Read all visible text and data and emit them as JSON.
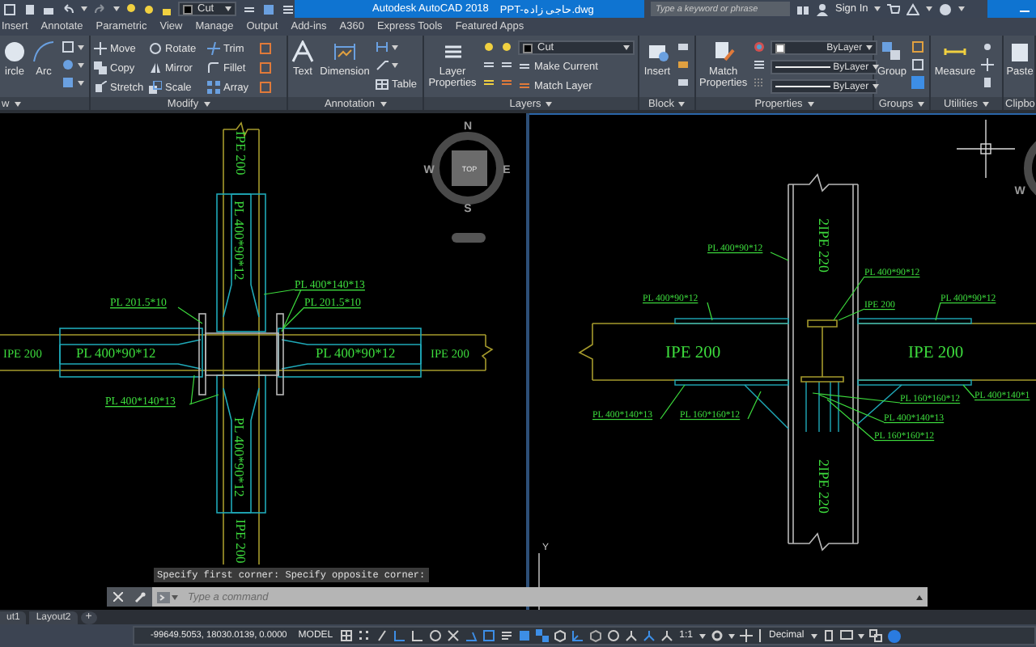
{
  "title_bar": {
    "layer": "Cut",
    "app_title": "Autodesk AutoCAD 2018",
    "file_name": "PPT-حاجی زاده.dwg",
    "search": {
      "placeholder": "Type a keyword or phrase"
    },
    "sign_in": "Sign In"
  },
  "ribbon_tabs": [
    "Insert",
    "Annotate",
    "Parametric",
    "View",
    "Manage",
    "Output",
    "Add-ins",
    "A360",
    "Express Tools",
    "Featured Apps"
  ],
  "ribbon": {
    "draw": {
      "title": "w",
      "tools": [
        "ircle",
        "Arc"
      ]
    },
    "modify": {
      "title": "Modify",
      "tools": [
        "Move",
        "Rotate",
        "Trim",
        "Copy",
        "Mirror",
        "Fillet",
        "Stretch",
        "Scale",
        "Array"
      ]
    },
    "annotation": {
      "title": "Annotation",
      "tools": [
        "Text",
        "Dimension",
        "Table"
      ]
    },
    "layers": {
      "title": "Layers",
      "layer": "Cut",
      "tools": [
        "Layer Properties",
        "Make Current",
        "Match Layer"
      ]
    },
    "block": {
      "title": "Block",
      "tools": [
        "Insert"
      ]
    },
    "properties": {
      "title": "Properties",
      "tools": [
        "Match Properties"
      ],
      "dropdowns": [
        "ByLayer",
        "ByLayer",
        "ByLayer"
      ]
    },
    "groups": {
      "title": "Groups",
      "tools": [
        "Group"
      ]
    },
    "utilities": {
      "title": "Utilities",
      "tools": [
        "Measure"
      ]
    },
    "clipboard": {
      "title": "Clipbo",
      "tools": [
        "Paste"
      ]
    }
  },
  "left_viewport": {
    "compass": {
      "north": "N",
      "east": "E",
      "south": "S",
      "west": "W",
      "view": "TOP"
    },
    "labels": [
      "IPE 200",
      "PL 400*90*12",
      "PL 400*140*13",
      "PL 201.5*10",
      "PL 201.5*10",
      "IPE 200",
      "PL 400*90*12",
      "PL 400*90*12",
      "IPE 200",
      "PL 400*140*13",
      "PL 400*90*12",
      "IPE 200"
    ]
  },
  "right_viewport": {
    "compass": {
      "west": "W"
    },
    "ucs": {
      "y_axis": "Y"
    },
    "labels": [
      "2IPE 220",
      "PL 400*90*12",
      "PL 400*90*12",
      "PL 400*90*12",
      "PL 400*90*12",
      "IPE 200",
      "IPE 200",
      "IPE 200",
      "PL 160*160*12",
      "PL 400*140*1",
      "PL 400*140*13",
      "PL 160*160*12",
      "PL 400*140*13",
      "PL 160*160*12",
      "2IPE 220"
    ]
  },
  "command_line": {
    "history": "Specify first corner: Specify opposite corner:",
    "placeholder": "Type a command"
  },
  "layout_tabs": [
    "ut1",
    "Layout2"
  ],
  "add_layout": "+",
  "status_bar": {
    "coordinates": "-99649.5053, 18030.0139, 0.0000",
    "space": "MODEL",
    "scale": "1:1",
    "units": "Decimal"
  }
}
